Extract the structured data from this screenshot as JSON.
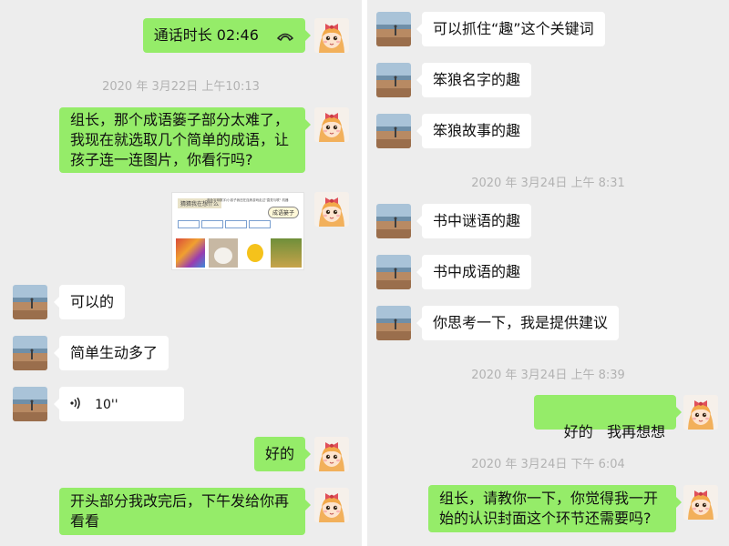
{
  "left_chat": {
    "call_record": "通话时长 02:46",
    "timestamp_1": "2020 年 3月22日 上午10:13",
    "msg_1": "组长，那个成语篓子部分太难了，我现在就选取几个简单的成语，让孩子连一连图片，你看行吗?",
    "image_msg": {
      "header_title": "猜猜我在想什么",
      "header_subtitle": "蓝色字母数字/小孩子我还在连练游戏走过\"直觉与联\" 机器",
      "badge": "成语篓子"
    },
    "reply_1": "可以的",
    "reply_2": "简单生动多了",
    "voice_duration": "10''",
    "msg_2": "好的",
    "msg_3": "开头部分我改完后，下午发给你再看看"
  },
  "right_chat": {
    "msg_1": "可以抓住“趣”这个关键词",
    "msg_2": "笨狼名字的趣",
    "msg_3": "笨狼故事的趣",
    "timestamp_1": "2020 年 3月24日 上午 8:31",
    "msg_4": "书中谜语的趣",
    "msg_5": "书中成语的趣",
    "msg_6": "你思考一下，我是提供建议",
    "timestamp_2": "2020 年 3月24日 上午 8:39",
    "msg_7": "好的   我再想想",
    "timestamp_3": "2020 年 3月24日 下午 6:04",
    "msg_8": "组长，请教你一下，你觉得我一开始的认识封面这个环节还需要吗?"
  },
  "colors": {
    "chat_bg": "#ededed",
    "my_bubble": "#95ec69",
    "other_bubble": "#ffffff",
    "timestamp_text": "#b2b2b2"
  },
  "icons": {
    "call_ended": "phone-handset-icon",
    "voice": "voice-wave-icon",
    "my_avatar": "cartoon-girl-avatar",
    "other_avatar": "beach-photo-avatar"
  }
}
